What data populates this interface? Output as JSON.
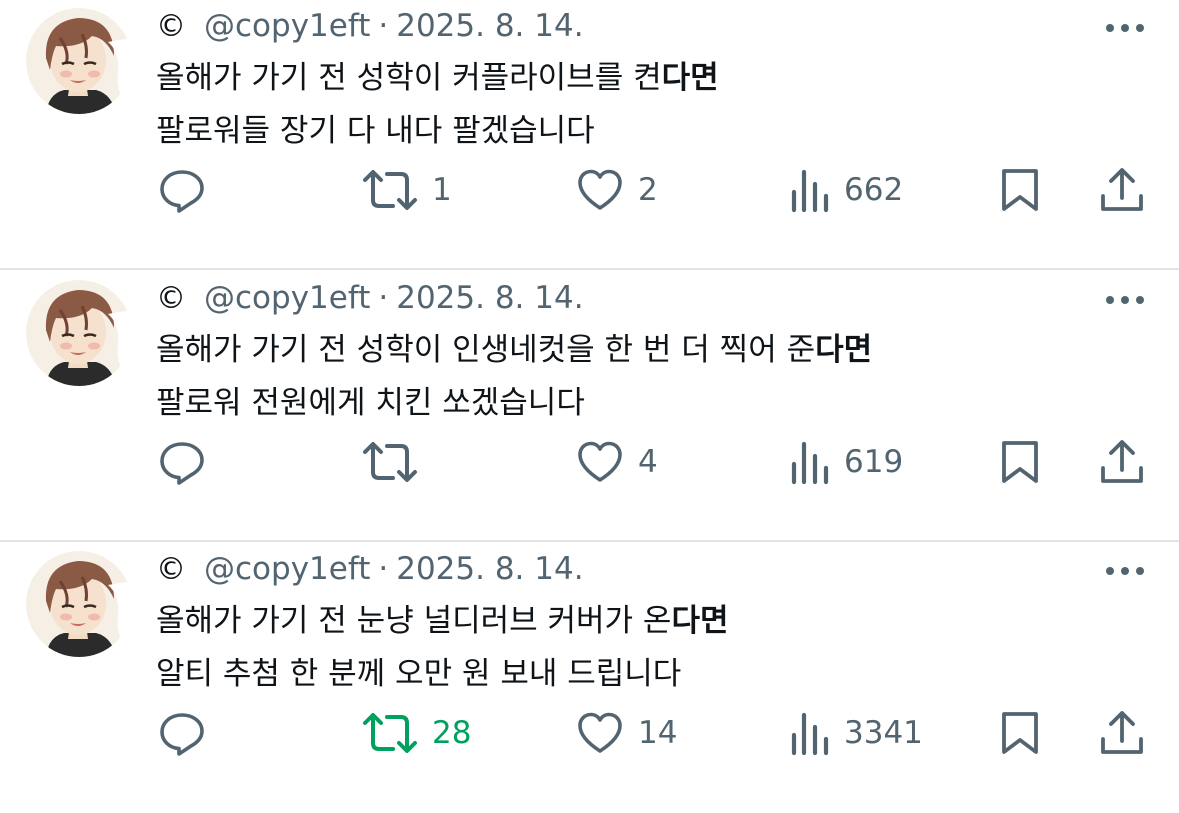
{
  "tweets": [
    {
      "copyright_mark": "©",
      "handle": "@copy1eft",
      "separator": "·",
      "date": "2025. 8. 14.",
      "line1_plain": "올해가 가기 전 성학이 커플라이브를 켠",
      "line1_bold": "다면",
      "line2": "팔로워들 장기 다 내다 팔겠습니다",
      "reposts": "1",
      "likes": "2",
      "views": "662",
      "reposted": false
    },
    {
      "copyright_mark": "©",
      "handle": "@copy1eft",
      "separator": "·",
      "date": "2025. 8. 14.",
      "line1_plain": "올해가 가기 전 성학이 인생네컷을 한 번 더 찍어 준",
      "line1_bold": "다면",
      "line2": "팔로워 전원에게 치킨 쏘겠습니다",
      "reposts": "",
      "likes": "4",
      "views": "619",
      "reposted": false
    },
    {
      "copyright_mark": "©",
      "handle": "@copy1eft",
      "separator": "·",
      "date": "2025. 8. 14.",
      "line1_plain": "올해가 가기 전 눈냥 널디러브 커버가 온",
      "line1_bold": "다면",
      "line2": "알티 추첨 한 분께 오만 원 보내 드립니다",
      "reposts": "28",
      "likes": "14",
      "views": "3341",
      "reposted": true
    }
  ],
  "colors": {
    "text": "#0f1419",
    "secondary": "#536471",
    "repost_active": "#00a05f",
    "divider": "#dfe4e4"
  },
  "icons": [
    "reply-icon",
    "repost-icon",
    "like-icon",
    "views-icon",
    "bookmark-icon",
    "share-icon",
    "more-icon"
  ]
}
